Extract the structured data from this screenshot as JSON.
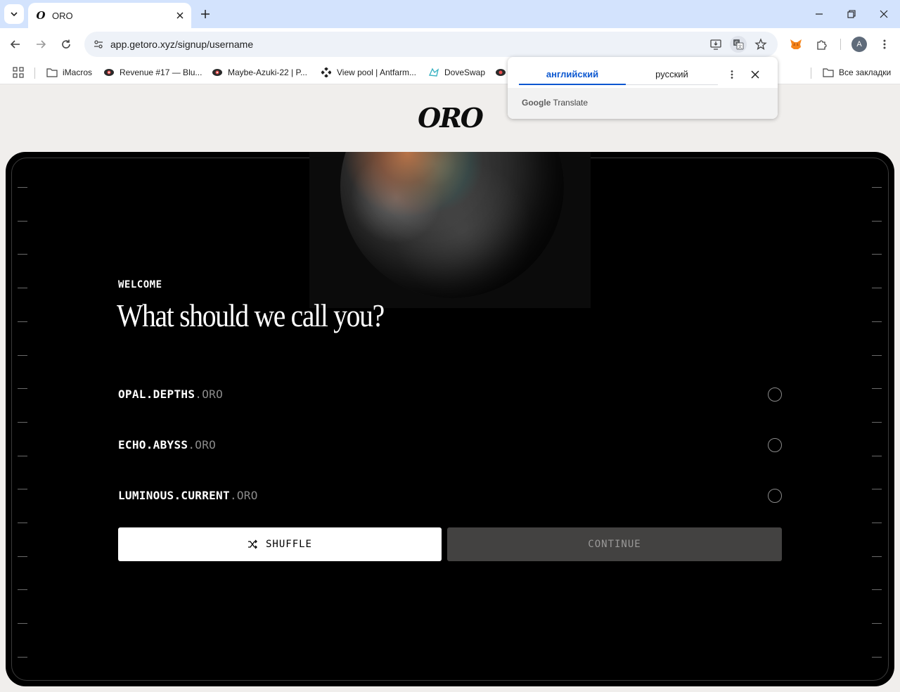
{
  "browser": {
    "tab": {
      "title": "ORO",
      "favicon_glyph": "O"
    },
    "url": "app.getoro.xyz/signup/username",
    "profile_initial": "A",
    "bookmarks": [
      {
        "label": "iMacros",
        "icon": "folder-icon"
      },
      {
        "label": "Revenue #17 — Blu...",
        "icon": "eye-logo-icon"
      },
      {
        "label": "Maybe-Azuki-22 | P...",
        "icon": "eye-logo-icon"
      },
      {
        "label": "View pool | Antfarm...",
        "icon": "diamond-logo-icon"
      },
      {
        "label": "DoveSwap",
        "icon": "dove-logo-icon"
      }
    ],
    "all_bookmarks": "Все закладки"
  },
  "translate": {
    "lang_source": "английский",
    "lang_target": "русский",
    "brand_google": "Google",
    "brand_translate": "Translate"
  },
  "page": {
    "logo": "ORO",
    "welcome": "WELCOME",
    "title": "What should we call you?",
    "options": [
      {
        "name": "OPAL.DEPTHS",
        "suffix": ".ORO"
      },
      {
        "name": "ECHO.ABYSS",
        "suffix": ".ORO"
      },
      {
        "name": "LUMINOUS.CURRENT",
        "suffix": ".ORO"
      }
    ],
    "shuffle_label": "SHUFFLE",
    "continue_label": "CONTINUE"
  },
  "colors": {
    "accent_blue": "#0b57d0",
    "frame_bg": "#000000",
    "continue_bg": "#434241",
    "page_bg": "#f0eeec"
  }
}
